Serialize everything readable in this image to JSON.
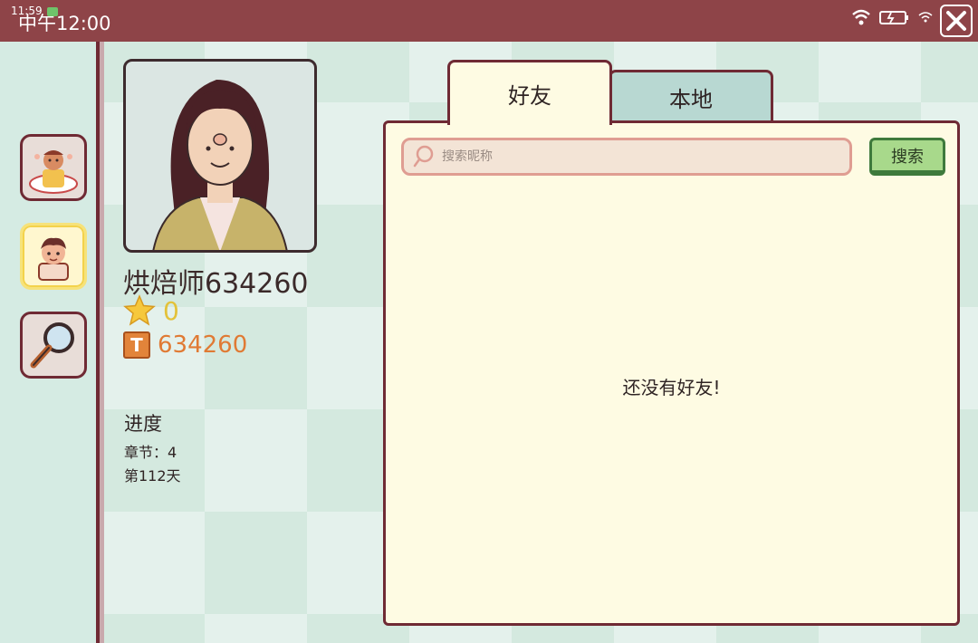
{
  "status_bar": {
    "time_small": "11:59",
    "clock": "中午12:00"
  },
  "player": {
    "name": "烘焙师634260",
    "stars": "0",
    "tickets": "634260"
  },
  "progress": {
    "title": "进度",
    "chapter": "章节：4",
    "day": "第112天"
  },
  "tabs": [
    {
      "label": "好友",
      "active": true
    },
    {
      "label": "本地",
      "active": false
    }
  ],
  "search": {
    "placeholder": "搜索昵称",
    "value": "",
    "button_label": "搜索"
  },
  "empty_message": "还没有好友!",
  "sidebar": {
    "items": [
      {
        "icon": "chef-avatar-icon",
        "active": false
      },
      {
        "icon": "friends-avatar-icon",
        "active": true
      },
      {
        "icon": "magnifier-icon",
        "active": false
      }
    ]
  },
  "colors": {
    "topbar": "#8e4448",
    "border": "#6f2a34",
    "panel": "#fefbe3",
    "tab_inactive": "#b8d8d2",
    "search_button": "#a8d98b",
    "stars_text": "#e3c23a",
    "tickets_text": "#e07a34"
  }
}
